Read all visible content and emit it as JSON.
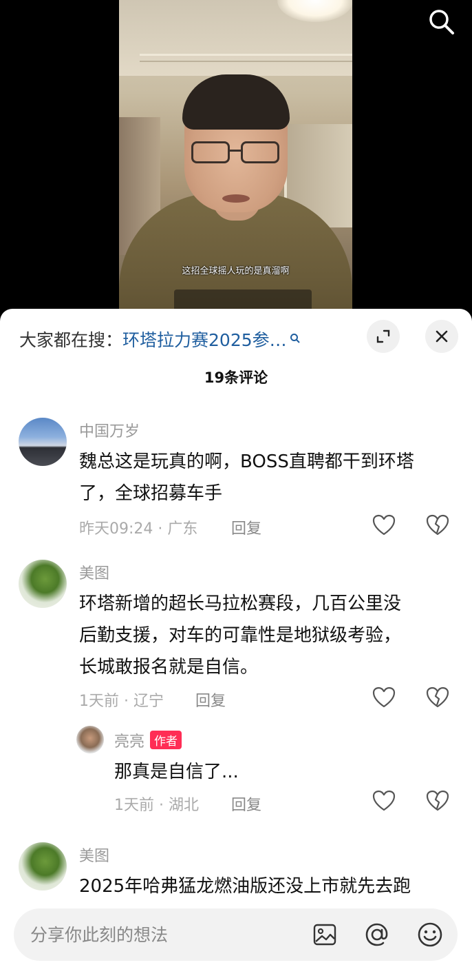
{
  "video": {
    "subtitle": "这招全球摇人玩的是真溜啊"
  },
  "panel": {
    "hot_search_label": "大家都在搜：",
    "hot_search_link": "环塔拉力赛2025参…",
    "comment_count": "19条评论"
  },
  "comments": [
    {
      "username": "中国万岁",
      "lines": [
        "魏总这是玩真的啊，BOSS直聘都干到环塔",
        "了，全球招募车手"
      ],
      "meta": "昨天09:24 · 广东",
      "reply_label": "回复"
    },
    {
      "username": "美图",
      "lines": [
        "环塔新增的超长马拉松赛段，几百公里没",
        "后勤支援，对车的可靠性是地狱级考验，",
        "长城敢报名就是自信。"
      ],
      "meta": "1天前 · 辽宁",
      "reply_label": "回复",
      "replies": [
        {
          "username": "亮亮",
          "badge": "作者",
          "text": "那真是自信了...",
          "meta": "1天前 · 湖北",
          "reply_label": "回复"
        }
      ]
    },
    {
      "username": "美图",
      "lines": [
        "2025年哈弗猛龙燃油版还没上市就先去跑"
      ]
    }
  ],
  "input": {
    "placeholder": "分享你此刻的想法"
  },
  "icons": {
    "search": "search-icon",
    "expand": "expand-icon",
    "close": "close-icon",
    "like": "heart-icon",
    "dislike": "broken-heart-icon",
    "image": "image-icon",
    "mention": "at-icon",
    "emoji": "emoji-icon"
  }
}
